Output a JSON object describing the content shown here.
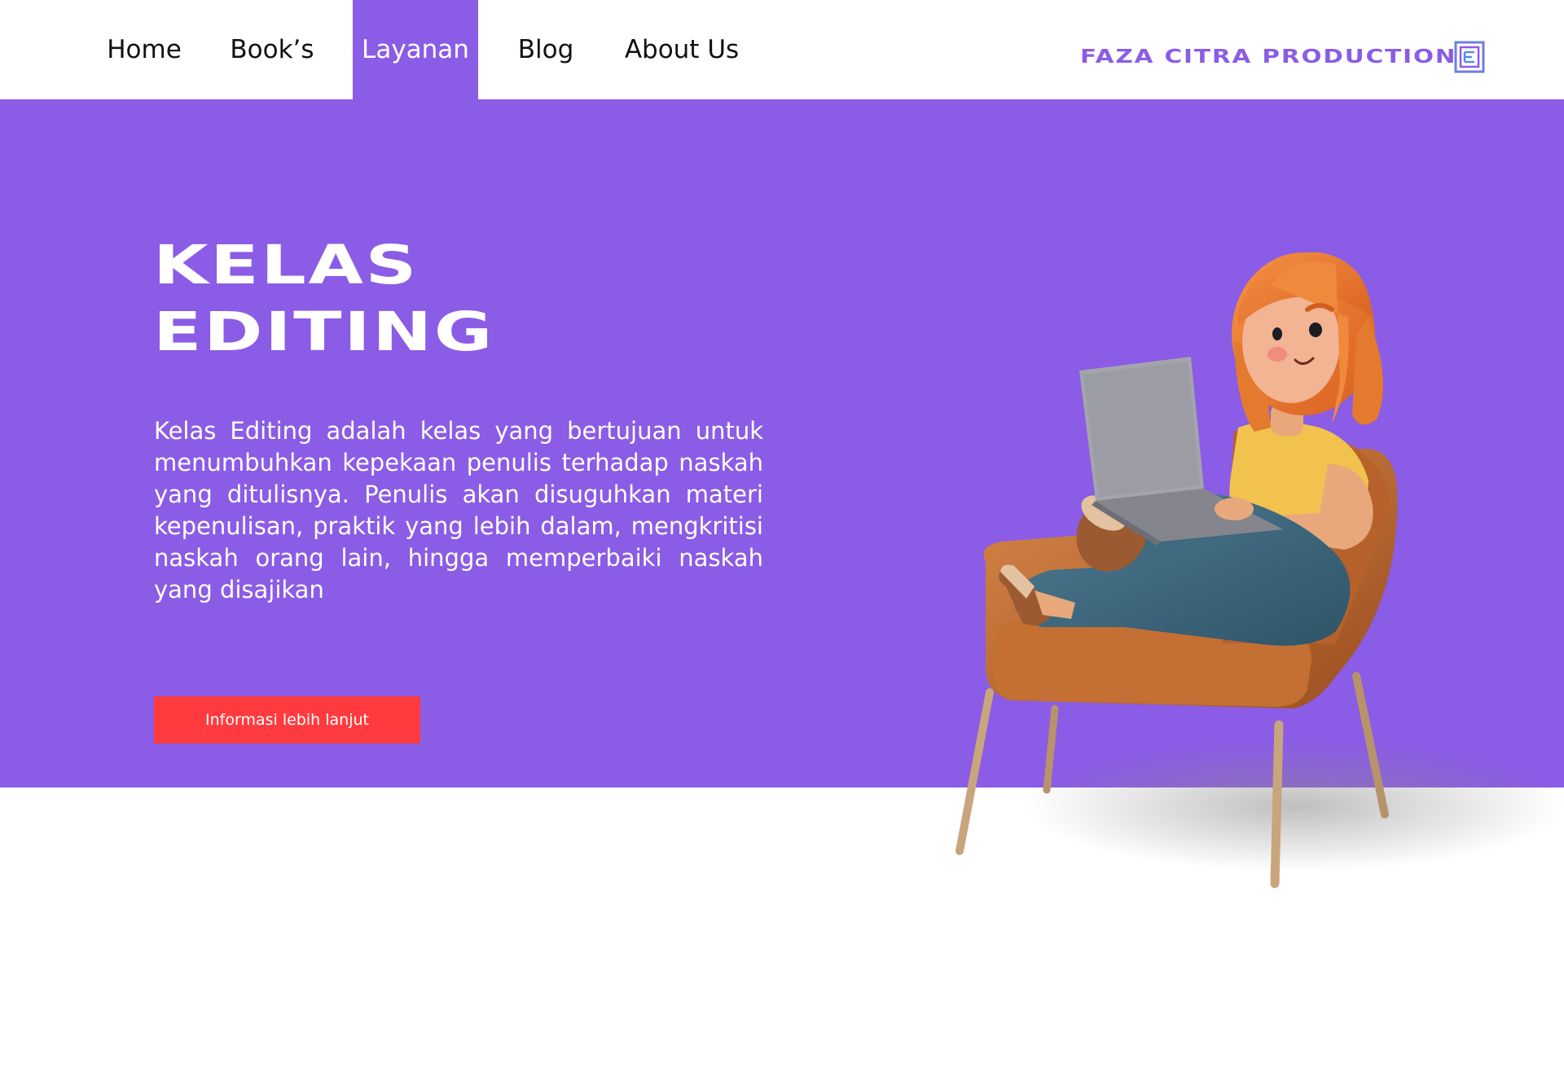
{
  "nav": {
    "items": [
      {
        "label": "Home"
      },
      {
        "label": "Book’s"
      },
      {
        "label": "Layanan",
        "active": true
      },
      {
        "label": "Blog"
      },
      {
        "label": "About Us"
      }
    ]
  },
  "brand": {
    "name": "FAZA CITRA PRODUCTION",
    "logo_icon": "fcp-logo-icon"
  },
  "hero": {
    "title_line1": "KELAS",
    "title_line2": "EDITING",
    "description": "Kelas Editing adalah kelas yang bertujuan untuk menumbuhkan kepekaan penulis terhadap naskah yang ditulisnya. Penulis akan disuguhkan materi kepenulisan, praktik yang lebih dalam, mengkritisi naskah orang lain, hingga memperbaiki naskah yang disajikan",
    "cta_label": "Informasi lebih lanjut",
    "illustration": "girl-on-armchair-with-laptop"
  },
  "colors": {
    "accent": "#8B5CE5",
    "cta": "#FF3B3F",
    "text_dark": "#111111",
    "background": "#FFFFFF"
  }
}
